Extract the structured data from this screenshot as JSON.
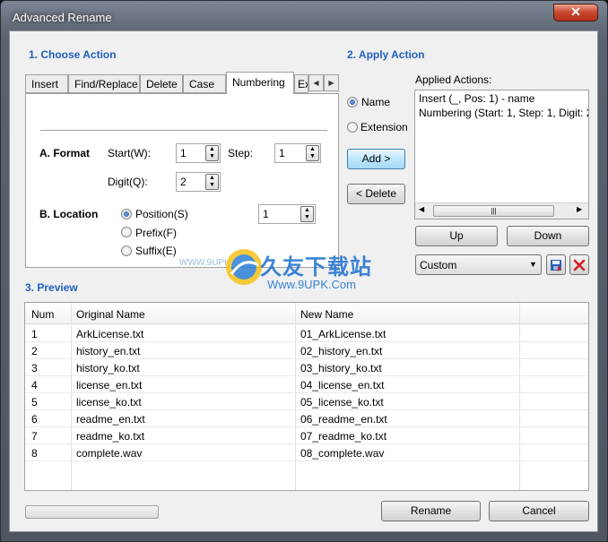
{
  "window": {
    "title": "Advanced Rename",
    "close": "✕"
  },
  "choose": {
    "title": "1. Choose Action",
    "tabs": [
      "Insert",
      "Find/Replace",
      "Delete",
      "Case",
      "Numbering",
      "Ex"
    ],
    "active_tab": "Numbering",
    "format_label": "A. Format",
    "start_label": "Start(W):",
    "start_value": "1",
    "step_label": "Step:",
    "step_value": "1",
    "digit_label": "Digit(Q):",
    "digit_value": "2",
    "location_label": "B. Location",
    "location_options": [
      "Position(S)",
      "Prefix(F)",
      "Suffix(E)"
    ],
    "location_selected": "Position(S)",
    "position_value": "1"
  },
  "apply": {
    "title": "2. Apply Action",
    "target_options": [
      "Name",
      "Extension"
    ],
    "target_selected": "Name",
    "add_label": "Add >",
    "delete_label": "< Delete",
    "applied_label": "Applied Actions:",
    "applied_items": [
      "Insert (_, Pos: 1) - name",
      "Numbering (Start: 1, Step: 1, Digit: 2"
    ],
    "scroll_thumb": "|||",
    "up_label": "Up",
    "down_label": "Down",
    "preset_value": "Custom"
  },
  "preview": {
    "title": "3. Preview",
    "columns": [
      "Num",
      "Original Name",
      "New Name"
    ],
    "rows": [
      [
        "1",
        "ArkLicense.txt",
        "01_ArkLicense.txt"
      ],
      [
        "2",
        "history_en.txt",
        "02_history_en.txt"
      ],
      [
        "3",
        "history_ko.txt",
        "03_history_ko.txt"
      ],
      [
        "4",
        "license_en.txt",
        "04_license_en.txt"
      ],
      [
        "5",
        "license_ko.txt",
        "05_license_ko.txt"
      ],
      [
        "6",
        "readme_en.txt",
        "06_readme_en.txt"
      ],
      [
        "7",
        "readme_ko.txt",
        "07_readme_ko.txt"
      ],
      [
        "8",
        "complete.wav",
        "08_complete.wav"
      ]
    ]
  },
  "footer": {
    "rename_label": "Rename",
    "cancel_label": "Cancel"
  },
  "watermark": {
    "site": "WWW.9UPK.COM",
    "brand": "久友下载站",
    "url": "Www.9UPK.Com"
  },
  "colors": {
    "section": "#1f5fbf",
    "close": "#c9452d",
    "delete_icon": "#d42020",
    "save_icon": "#2a5fb0"
  }
}
